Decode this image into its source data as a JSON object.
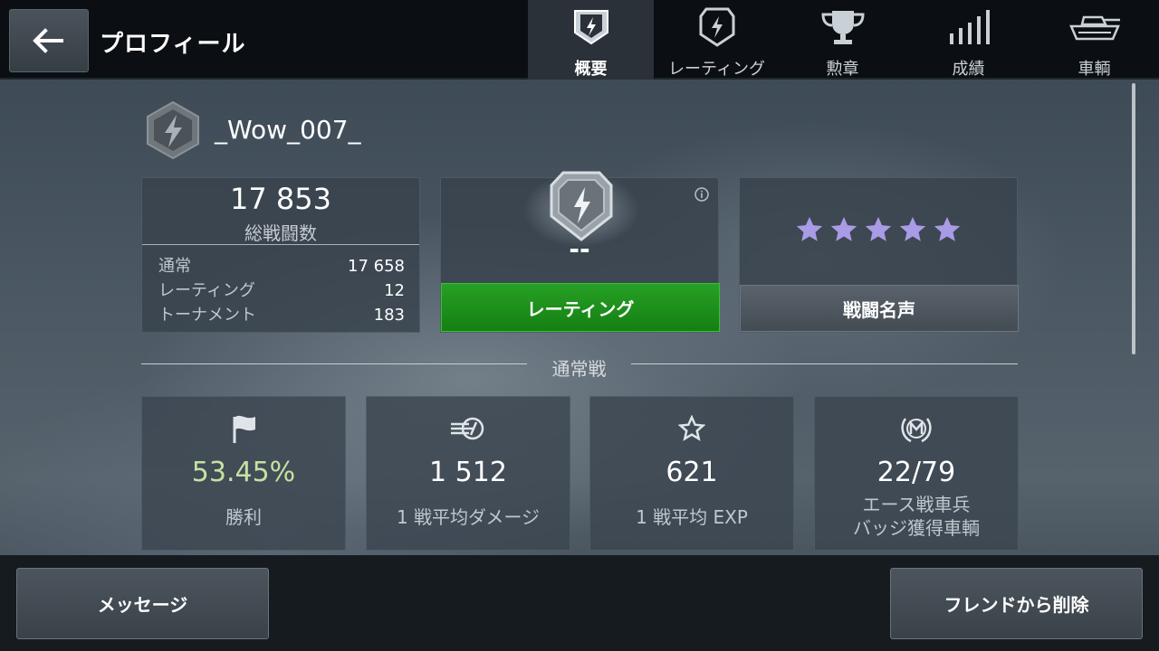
{
  "header": {
    "title": "プロフィール",
    "tabs": [
      {
        "label": "概要",
        "icon": "shield-bolt-icon",
        "active": true
      },
      {
        "label": "レーティング",
        "icon": "rating-shield-icon",
        "active": false
      },
      {
        "label": "勲章",
        "icon": "trophy-icon",
        "active": false
      },
      {
        "label": "成績",
        "icon": "bar-chart-icon",
        "active": false
      },
      {
        "label": "車輌",
        "icon": "tank-icon",
        "active": false
      }
    ]
  },
  "player": {
    "name": "_Wow_007_"
  },
  "battles": {
    "total": "17 853",
    "total_label": "総戦闘数",
    "breakdown": [
      {
        "label": "通常",
        "value": "17 658"
      },
      {
        "label": "レーティング",
        "value": "12"
      },
      {
        "label": "トーナメント",
        "value": "183"
      }
    ]
  },
  "rating": {
    "value": "--",
    "button_label": "レーティング"
  },
  "fame": {
    "stars": 5,
    "star_color": "#a99be6",
    "button_label": "戦闘名声"
  },
  "section": {
    "title": "通常戦"
  },
  "stats": [
    {
      "icon": "flag-icon",
      "value": "53.45%",
      "label": "勝利"
    },
    {
      "icon": "damage-icon",
      "value": "1 512",
      "label": "1 戦平均ダメージ"
    },
    {
      "icon": "star-outline-icon",
      "value": "621",
      "label": "1 戦平均 EXP"
    },
    {
      "icon": "ace-badge-icon",
      "value": "22/79",
      "label_line1": "エース戦車兵",
      "label_line2": "バッジ獲得車輌"
    }
  ],
  "footer": {
    "message_label": "メッセージ",
    "unfriend_label": "フレンドから削除"
  },
  "colors": {
    "rating_button": "#1f8f1c",
    "win_rate": "#c7e0a2"
  }
}
